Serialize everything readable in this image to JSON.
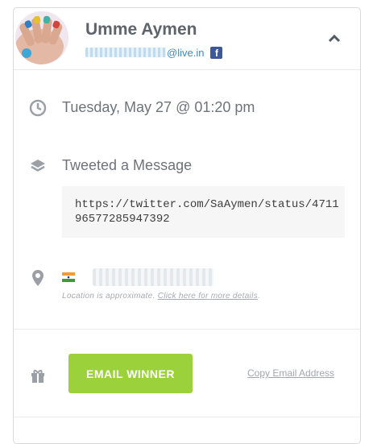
{
  "user": {
    "name": "Umme Aymen",
    "email_visible_domain": "@live.in",
    "social_icon": "facebook-icon"
  },
  "entry": {
    "date": "Tuesday, May 27 @ 01:20 pm",
    "action": "Tweeted a Message",
    "message": "https://twitter.com/SaAymen/status/471196577285947392"
  },
  "location": {
    "note": "Location is approximate.",
    "link": "Click here for more details",
    "flag": "india-flag"
  },
  "actions": {
    "email_winner": "EMAIL WINNER",
    "copy_email": "Copy Email Address"
  },
  "colors": {
    "accent_green": "#9bd23c",
    "link_blue": "#3a8ac7",
    "facebook_blue": "#3b5998"
  }
}
